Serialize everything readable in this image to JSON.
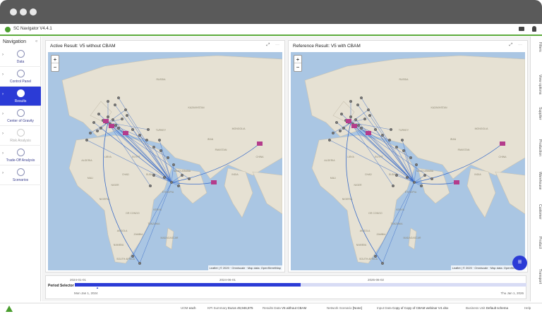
{
  "app": {
    "title": "SC Navigator V4.4.1"
  },
  "sidebar": {
    "heading": "Navigation",
    "close": "«",
    "items": [
      {
        "label": "Data",
        "icon": "database-icon"
      },
      {
        "label": "Control Panel",
        "icon": "control-panel-icon"
      },
      {
        "label": "Results",
        "icon": "results-icon",
        "active": true
      },
      {
        "label": "Center of Gravity",
        "icon": "target-icon"
      },
      {
        "label": "Risk Analysis",
        "icon": "risk-icon",
        "disabled": true
      },
      {
        "label": "Trade-Off Analysis",
        "icon": "tradeoff-icon"
      },
      {
        "label": "Scenarios",
        "icon": "scenarios-icon"
      }
    ]
  },
  "panels": [
    {
      "title": "Active Result: V5 without CBAM",
      "tools": "⤢ ⋯"
    },
    {
      "title": "Reference Result: V5 with CBAM",
      "tools": "⤢ ⋯"
    }
  ],
  "map": {
    "zoom_in": "+",
    "zoom_out": "−",
    "attribution": "Leaflet | © 2020 · Omniscale · Map data: OpenStreetMap",
    "water_color": "#aac6e3",
    "land_color": "#e6e1d3",
    "flow_color": "#3a6cc8",
    "plant_color": "#b43c8c",
    "labels": [
      "RUSSIA",
      "KAZAKHSTAN",
      "MONGOLIA",
      "CHINA",
      "INDIA",
      "IRAN",
      "SAUDI ARABIA",
      "EGYPT",
      "LIBYA",
      "ALGERIA",
      "NIGER",
      "SUDAN",
      "CHAD",
      "NIGERIA",
      "ETHIOPIA",
      "DR CONGO",
      "KENYA",
      "TANZANIA",
      "ANGOLA",
      "ZAMBIA",
      "NAMIBIA",
      "SOUTH AFRICA",
      "MADAGASCAR",
      "MALI",
      "TURKEY",
      "PAKISTAN"
    ]
  },
  "period": {
    "label": "Period Selector",
    "ticks": [
      "2024-01-01",
      "2024-06-01",
      "2025-06-02"
    ],
    "start_date": "Mon Jan 1, 2024",
    "end_date": "Thu Jan 1, 2026",
    "selected_fraction": 0.5
  },
  "fab": {
    "icon": "menu-icon",
    "glyph": "≡"
  },
  "right_rail": [
    "Filters",
    "View options",
    "Supplier",
    "Production",
    "Warehouse",
    "Customer",
    "Product",
    "Transport"
  ],
  "status": {
    "uom": "UOM",
    "uom_value": "each",
    "kpi": "KPI Summary",
    "kpi_value": "Euros 49,946,875",
    "results_data": "Results Data",
    "results_value": "V5 without CBAM",
    "network": "Network Scenario",
    "network_value": "[None]",
    "input": "Input Data",
    "input_value": "Copy of Copy of CBAM webinar V4.xlsx",
    "business": "Business Unit",
    "business_value": "Default schema",
    "help": "Help"
  }
}
